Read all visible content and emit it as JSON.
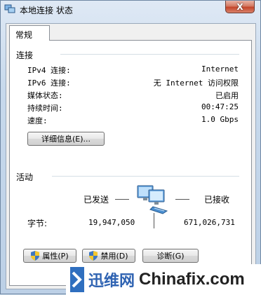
{
  "window": {
    "title": "本地连接 状态",
    "close_glyph": "X"
  },
  "tabs": [
    {
      "label": "常规"
    }
  ],
  "connection": {
    "section_title": "连接",
    "rows": [
      {
        "label": "IPv4 连接:",
        "value": "Internet"
      },
      {
        "label": "IPv6 连接:",
        "value": "无 Internet 访问权限"
      },
      {
        "label": "媒体状态:",
        "value": "已启用"
      },
      {
        "label": "持续时间:",
        "value": "00:47:25"
      },
      {
        "label": "速度:",
        "value": "1.0 Gbps"
      }
    ],
    "details_button": "详细信息(E)..."
  },
  "activity": {
    "section_title": "活动",
    "sent_label": "已发送",
    "received_label": "已接收",
    "bytes_label": "字节:",
    "bytes_sent": "19,947,050",
    "bytes_received": "671,026,731"
  },
  "buttons": {
    "properties": "属性(P)",
    "disable": "禁用(D)",
    "diagnose": "诊断(G)"
  },
  "watermark": {
    "brand_cn": "迅维网",
    "brand_en": "Chinafix.com"
  },
  "colors": {
    "accent_blue": "#2f63b2",
    "window_frame": "#bcd0e6"
  }
}
